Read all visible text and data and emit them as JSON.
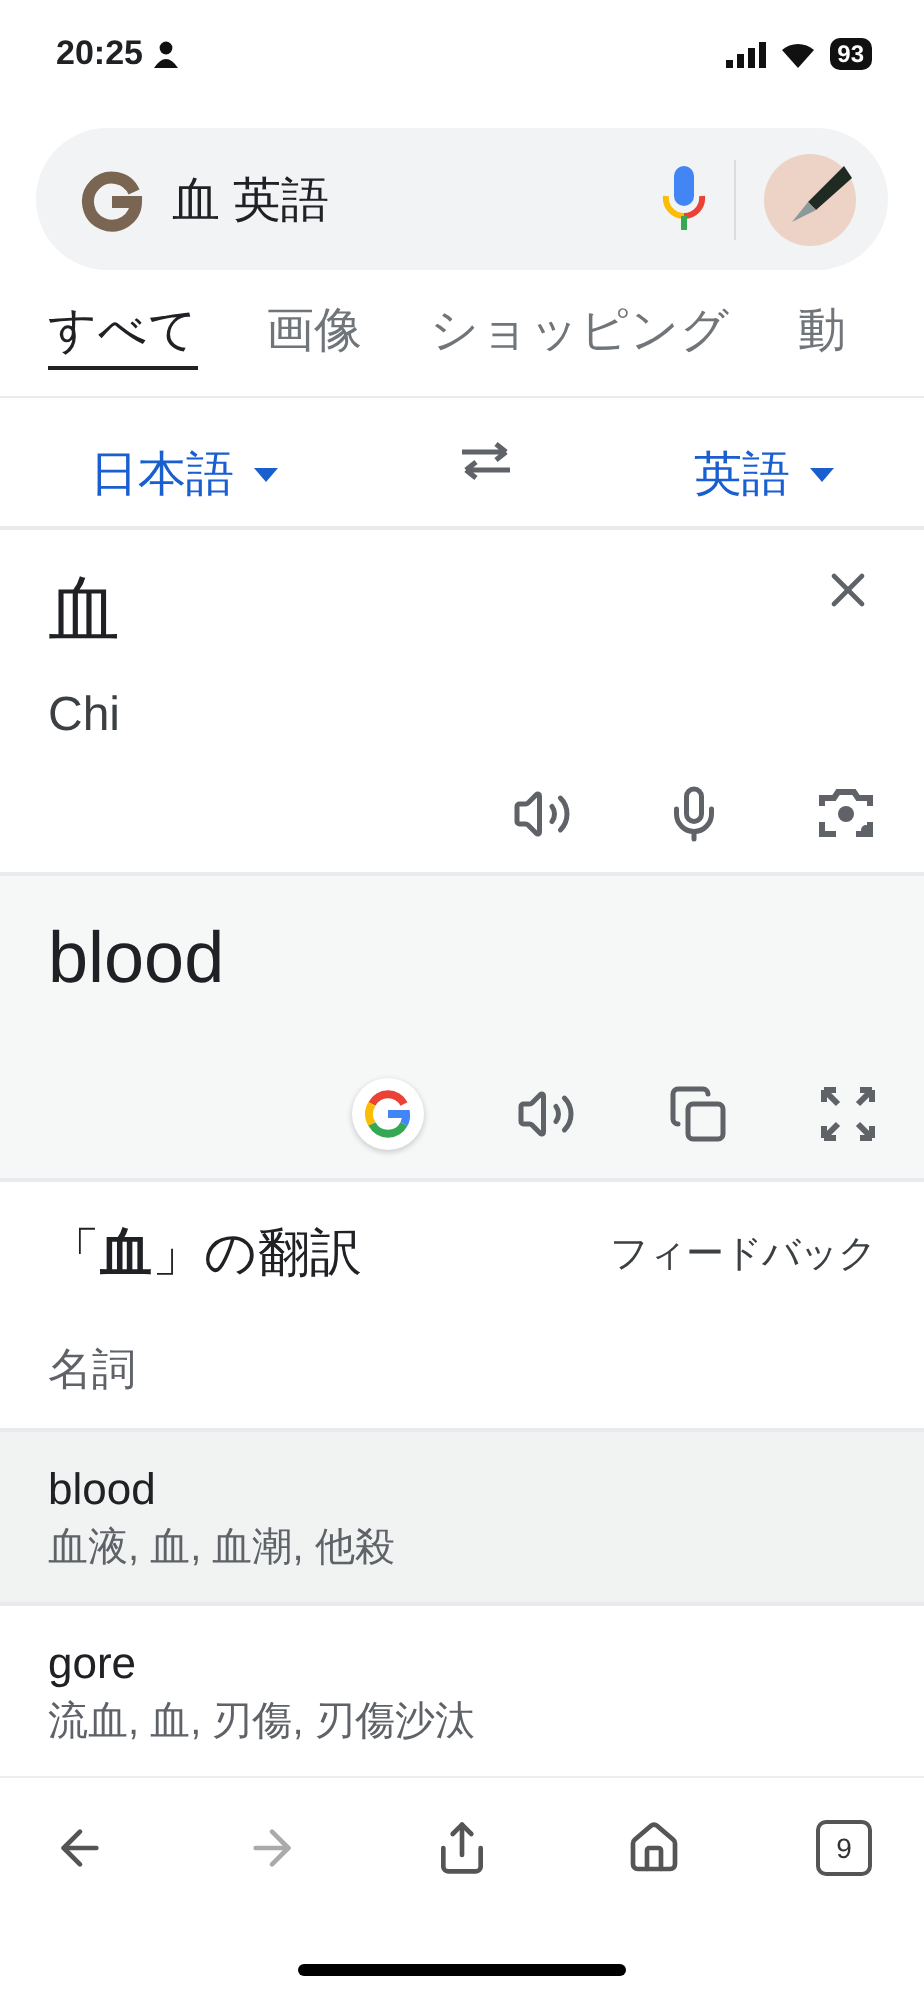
{
  "status_bar": {
    "time": "20:25",
    "battery": "93"
  },
  "search": {
    "value": "血 英語"
  },
  "tabs": [
    {
      "label": "すべて",
      "selected": true
    },
    {
      "label": "画像",
      "selected": false
    },
    {
      "label": "ショッピング",
      "selected": false
    },
    {
      "label": "動",
      "selected": false
    }
  ],
  "translator": {
    "source_language": "日本語",
    "target_language": "英語",
    "source_text": "血",
    "romanization": "Chi",
    "translation": "blood"
  },
  "translations": {
    "heading": "「**血**」の翻訳",
    "feedback": "フィードバック",
    "part_of_speech": "名詞",
    "rows": [
      {
        "word": "blood",
        "meanings": "血液, 血, 血潮, 他殺",
        "selected": true
      },
      {
        "word": "gore",
        "meanings": "流血, 血, 刃傷, 刃傷沙汰",
        "selected": false
      }
    ]
  },
  "toolbar": {
    "tab_count": "9"
  }
}
